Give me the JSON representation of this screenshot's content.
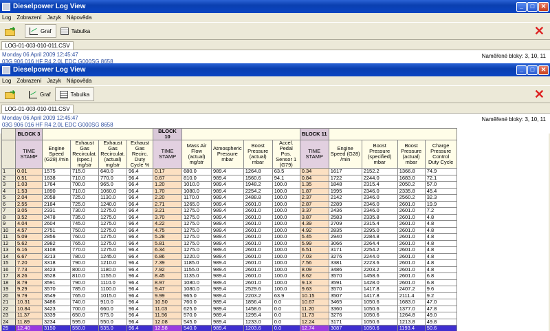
{
  "app": {
    "title": "Dieselpower Log View"
  },
  "menu": [
    "Log",
    "Zobrazení",
    "Jazyk",
    "Nápověda"
  ],
  "toolbar": {
    "graph_label": "Graf",
    "table_label": "Tabulka"
  },
  "file": {
    "tab": "LOG-01-003-010-011.CSV",
    "date": "Monday 06 April 2009 12:45:47",
    "engine": "03G 906 016 HF  R4 2.0L EDC G000SG   8658",
    "blocks": "Naměřené bloky: 3, 10, 11"
  },
  "colors": {
    "titlebar": "#0a3fb0",
    "timestamp": "#fce0c2",
    "selection": "#3f2fd0"
  },
  "table": {
    "blocks": [
      "BLOCK 3",
      "BLOCK 10",
      "BLOCK 11"
    ],
    "headers": [
      "TIME STAMP",
      "Engine Speed (G28) /min",
      "Exhaust Gas Recirculat. (spec.) mg/str",
      "Exhaust Gas Recirculat. (actual) mg/str",
      "Exhaust Gas Recirc. Duty Cycle %",
      "TIME STAMP",
      "Mass Air Flow (actual) mg/str",
      "Atmospheric Pressure mbar",
      "Boost Pressure (actual) mbar",
      "Accel. Pedal Pos. Sensor 1 (G79)",
      "TIME STAMP",
      "Engine Speed (G28) /min",
      "Boost Pressure (specified) mbar",
      "Boost Pressure (actual) mbar",
      "Charge Pressure Control Duty Cycle"
    ],
    "rows": [
      [
        "1",
        "0.01",
        "1575",
        "715.0",
        "640.0",
        "96.4",
        "0.17",
        "680.0",
        "989.4",
        "1264.8",
        "63.5",
        "0.34",
        "1617",
        "2152.2",
        "1366.8",
        "74.9"
      ],
      [
        "2",
        "0.51",
        "1638",
        "710.0",
        "770.0",
        "96.4",
        "0.67",
        "810.0",
        "989.4",
        "1560.6",
        "94.1",
        "0.84",
        "1722",
        "2244.0",
        "1683.0",
        "72.1"
      ],
      [
        "3",
        "1.03",
        "1764",
        "700.0",
        "965.0",
        "96.4",
        "1.20",
        "1010.0",
        "989.4",
        "1948.2",
        "100.0",
        "1.35",
        "1848",
        "2315.4",
        "2050.2",
        "57.0"
      ],
      [
        "4",
        "1.53",
        "1890",
        "710.0",
        "1060.0",
        "96.4",
        "1.70",
        "1080.0",
        "989.4",
        "2254.2",
        "100.0",
        "1.87",
        "1995",
        "2346.0",
        "2335.8",
        "45.4"
      ],
      [
        "5",
        "2.04",
        "2058",
        "725.0",
        "1130.0",
        "96.4",
        "2.20",
        "1170.0",
        "989.4",
        "2488.8",
        "100.0",
        "2.37",
        "2142",
        "2346.0",
        "2560.2",
        "32.3"
      ],
      [
        "6",
        "2.55",
        "2184",
        "725.0",
        "1240.0",
        "96.4",
        "2.71",
        "1265.0",
        "989.4",
        "2601.0",
        "100.0",
        "2.87",
        "2289",
        "2346.0",
        "2601.0",
        "19.9"
      ],
      [
        "7",
        "3.05",
        "2331",
        "730.0",
        "1275.0",
        "96.4",
        "3.21",
        "1275.0",
        "989.4",
        "2601.0",
        "100.0",
        "3.37",
        "2436",
        "2346.0",
        "2601.0",
        "7.2"
      ],
      [
        "8",
        "3.52",
        "2478",
        "735.0",
        "1275.0",
        "96.4",
        "3.70",
        "1275.0",
        "989.4",
        "2601.0",
        "100.0",
        "3.87",
        "2583",
        "2335.8",
        "2601.0",
        "4.8"
      ],
      [
        "9",
        "4.04",
        "2604",
        "745.0",
        "1275.0",
        "96.4",
        "4.22",
        "1275.0",
        "989.4",
        "2601.0",
        "100.0",
        "4.39",
        "2709",
        "2315.4",
        "2601.0",
        "4.8"
      ],
      [
        "10",
        "4.57",
        "2751",
        "750.0",
        "1275.0",
        "96.4",
        "4.75",
        "1275.0",
        "989.4",
        "2601.0",
        "100.0",
        "4.92",
        "2835",
        "2295.0",
        "2601.0",
        "4.8"
      ],
      [
        "11",
        "5.09",
        "2856",
        "760.0",
        "1275.0",
        "96.4",
        "5.28",
        "1275.0",
        "989.4",
        "2601.0",
        "100.0",
        "5.45",
        "2940",
        "2284.8",
        "2601.0",
        "4.8"
      ],
      [
        "12",
        "5.62",
        "2982",
        "765.0",
        "1275.0",
        "96.4",
        "5.81",
        "1275.0",
        "989.4",
        "2601.0",
        "100.0",
        "5.99",
        "3066",
        "2264.4",
        "2601.0",
        "4.8"
      ],
      [
        "13",
        "6.16",
        "3108",
        "770.0",
        "1275.0",
        "96.4",
        "6.34",
        "1275.0",
        "989.4",
        "2601.0",
        "100.0",
        "6.51",
        "3171",
        "2254.2",
        "2601.0",
        "4.8"
      ],
      [
        "14",
        "6.67",
        "3213",
        "780.0",
        "1245.0",
        "96.4",
        "6.86",
        "1220.0",
        "989.4",
        "2601.0",
        "100.0",
        "7.03",
        "3276",
        "2244.0",
        "2601.0",
        "4.8"
      ],
      [
        "15",
        "7.20",
        "3318",
        "790.0",
        "1210.0",
        "96.4",
        "7.39",
        "1185.0",
        "989.4",
        "2601.0",
        "100.0",
        "7.56",
        "3381",
        "2223.6",
        "2601.0",
        "4.8"
      ],
      [
        "16",
        "7.73",
        "3423",
        "800.0",
        "1180.0",
        "96.4",
        "7.92",
        "1155.0",
        "989.4",
        "2601.0",
        "100.0",
        "8.09",
        "3486",
        "2203.2",
        "2601.0",
        "4.8"
      ],
      [
        "17",
        "8.26",
        "3528",
        "810.0",
        "1155.0",
        "96.4",
        "8.45",
        "1135.0",
        "989.4",
        "2601.0",
        "100.0",
        "8.62",
        "3570",
        "1458.6",
        "2601.0",
        "6.8"
      ],
      [
        "18",
        "8.79",
        "3591",
        "790.0",
        "1110.0",
        "96.4",
        "8.97",
        "1080.0",
        "989.4",
        "2601.0",
        "100.0",
        "9.13",
        "3591",
        "1428.0",
        "2601.0",
        "6.8"
      ],
      [
        "19",
        "9.29",
        "3570",
        "785.0",
        "1100.0",
        "96.4",
        "9.47",
        "1080.0",
        "989.4",
        "2529.6",
        "100.0",
        "9.63",
        "3570",
        "1417.8",
        "2407.2",
        "9.6"
      ],
      [
        "20",
        "9.79",
        "3549",
        "765.0",
        "1015.0",
        "96.4",
        "9.99",
        "965.0",
        "989.4",
        "2203.2",
        "63.9",
        "10.15",
        "3507",
        "1417.8",
        "2111.4",
        "9.2"
      ],
      [
        "21",
        "10.31",
        "3486",
        "740.0",
        "910.0",
        "96.4",
        "10.50",
        "760.0",
        "989.4",
        "1856.4",
        "0.0",
        "10.67",
        "3465",
        "1050.6",
        "1683.0",
        "47.0"
      ],
      [
        "22",
        "10.84",
        "3423",
        "700.0",
        "660.0",
        "96.4",
        "11.03",
        "625.0",
        "989.4",
        "1458.6",
        "0.0",
        "11.20",
        "3360",
        "1050.6",
        "1377.0",
        "47.8"
      ],
      [
        "23",
        "11.37",
        "3339",
        "650.0",
        "575.0",
        "96.4",
        "11.56",
        "570.0",
        "989.4",
        "1295.4",
        "0.0",
        "11.73",
        "3276",
        "1050.6",
        "1264.8",
        "49.0"
      ],
      [
        "24",
        "11.89",
        "3234",
        "595.0",
        "550.0",
        "96.4",
        "12.08",
        "545.0",
        "989.4",
        "1233.0",
        "0.0",
        "12.24",
        "3171",
        "1050.6",
        "1213.8",
        "49.8"
      ],
      [
        "25",
        "12.40",
        "3150",
        "550.0",
        "535.0",
        "96.4",
        "12.58",
        "540.0",
        "989.4",
        "1203.6",
        "0.0",
        "12.74",
        "3087",
        "1050.6",
        "1193.4",
        "50.6"
      ]
    ]
  }
}
